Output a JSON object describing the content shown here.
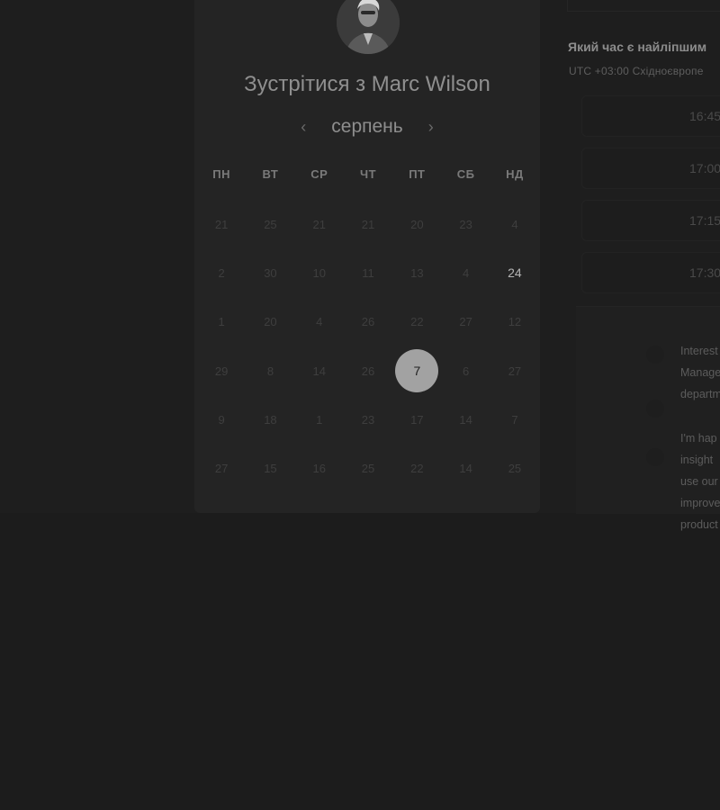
{
  "header": {
    "title": "Зустрітися з Marc Wilson"
  },
  "calendar": {
    "month": "серпень",
    "weekdays": [
      "ПН",
      "ВТ",
      "СР",
      "ЧТ",
      "ПТ",
      "СБ",
      "НД"
    ],
    "rows": [
      [
        "21",
        "25",
        "21",
        "21",
        "20",
        "23",
        "4"
      ],
      [
        "2",
        "30",
        "10",
        "11",
        "13",
        "4",
        "24"
      ],
      [
        "1",
        "20",
        "4",
        "26",
        "22",
        "27",
        "12"
      ],
      [
        "29",
        "8",
        "14",
        "26",
        "7",
        "6",
        "27"
      ],
      [
        "9",
        "18",
        "1",
        "23",
        "17",
        "14",
        "7"
      ],
      [
        "27",
        "15",
        "16",
        "25",
        "22",
        "14",
        "25"
      ]
    ],
    "available": [
      [
        1,
        6
      ]
    ],
    "selected": [
      3,
      4
    ]
  },
  "booking": {
    "question": "Який час є найліпшим",
    "timezone": "UTC +03:00 Східноєвропе",
    "slots": [
      "16:45",
      "17:00",
      "17:15",
      "17:30"
    ]
  },
  "message": {
    "lines": [
      "Interest",
      "Manage",
      "departm",
      "I'm hap",
      "insight",
      "use our",
      "improve",
      "product"
    ]
  },
  "icons": {
    "prev": "chevron-left-icon",
    "next": "chevron-right-icon"
  }
}
